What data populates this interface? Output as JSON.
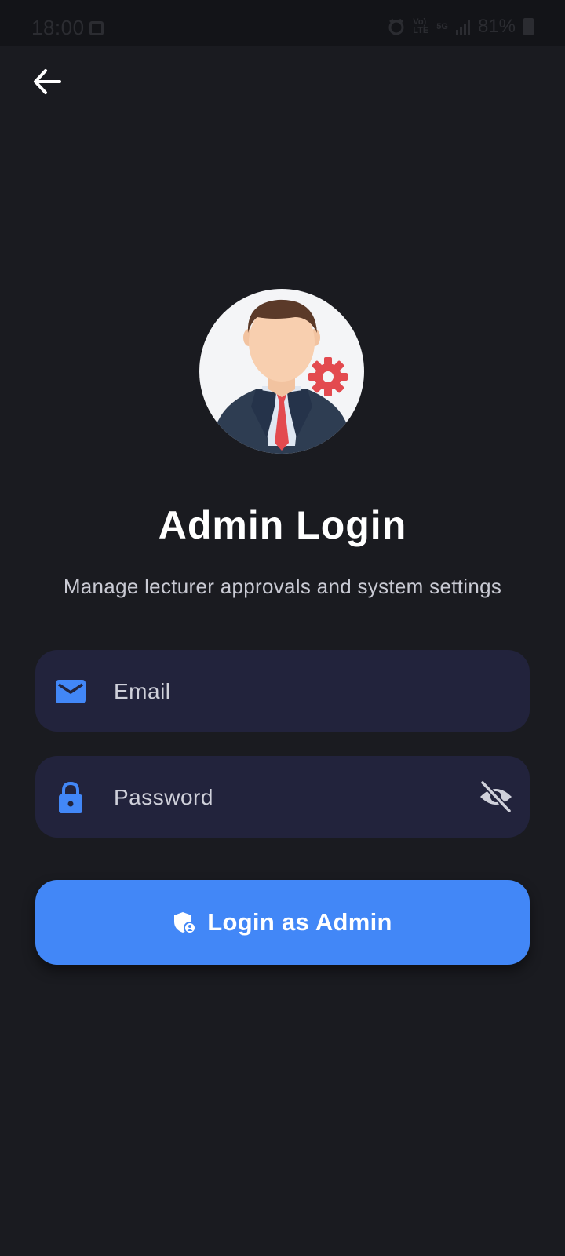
{
  "status_bar": {
    "time": "18:00",
    "network_label_1": "Vo)",
    "network_label_2": "LTE",
    "network_5g": "5G",
    "battery_percent": "81%"
  },
  "header": {
    "back_icon": "arrow-left-icon"
  },
  "avatar": {
    "icon": "admin-avatar-icon"
  },
  "title": "Admin Login",
  "subtitle": "Manage lecturer approvals and system settings",
  "form": {
    "email": {
      "placeholder": "Email",
      "value": "",
      "icon": "mail-icon"
    },
    "password": {
      "placeholder": "Password",
      "value": "",
      "icon": "lock-icon",
      "toggle_icon": "eye-off-icon"
    }
  },
  "login_button": {
    "label": "Login as Admin",
    "icon": "admin-shield-icon"
  },
  "colors": {
    "background": "#1a1b20",
    "field_background": "#22233c",
    "accent": "#4287f7",
    "text_primary": "#ffffff",
    "text_secondary": "#c9cad3",
    "avatar_gear": "#e34a4f"
  }
}
